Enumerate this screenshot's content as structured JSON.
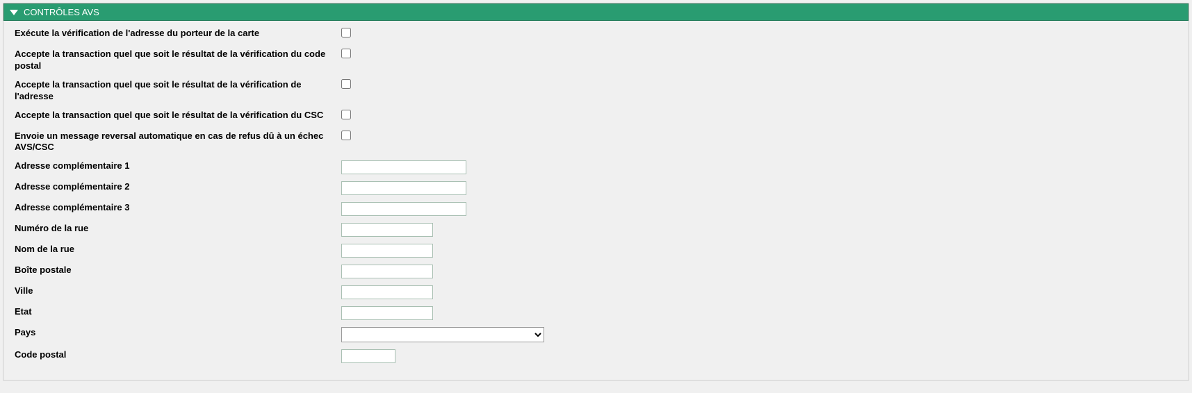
{
  "panel": {
    "title": "CONTRÔLES AVS"
  },
  "fields": {
    "execute_verify": {
      "label": "Exécute la vérification de l'adresse du porteur de la carte",
      "checked": false
    },
    "accept_postal": {
      "label": "Accepte la transaction quel que soit le résultat de la vérification du code postal",
      "checked": false
    },
    "accept_address": {
      "label": "Accepte la transaction quel que soit le résultat de la vérification de l'adresse",
      "checked": false
    },
    "accept_csc": {
      "label": "Accepte la transaction quel que soit le résultat de la vérification du CSC",
      "checked": false
    },
    "auto_reversal": {
      "label": "Envoie un message reversal automatique en cas de refus dû à un échec AVS/CSC",
      "checked": false
    },
    "addr1": {
      "label": "Adresse complémentaire 1",
      "value": ""
    },
    "addr2": {
      "label": "Adresse complémentaire 2",
      "value": ""
    },
    "addr3": {
      "label": "Adresse complémentaire 3",
      "value": ""
    },
    "street_num": {
      "label": "Numéro de la rue",
      "value": ""
    },
    "street_name": {
      "label": "Nom de la rue",
      "value": ""
    },
    "po_box": {
      "label": "Boîte postale",
      "value": ""
    },
    "city": {
      "label": "Ville",
      "value": ""
    },
    "state": {
      "label": "Etat",
      "value": ""
    },
    "country": {
      "label": "Pays",
      "selected": ""
    },
    "postal_code": {
      "label": "Code postal",
      "value": ""
    }
  }
}
